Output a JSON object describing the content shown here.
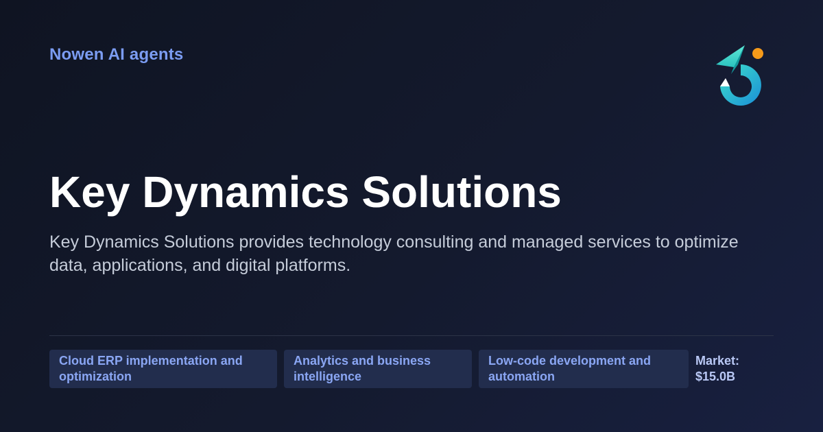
{
  "brand": {
    "name": "Nowen AI agents"
  },
  "company": {
    "title": "Key Dynamics Solutions",
    "description": "Key Dynamics Solutions provides technology consulting and managed services to optimize data, applications, and digital platforms."
  },
  "tags": [
    {
      "label": "Cloud ERP implementation and optimization"
    },
    {
      "label": "Analytics and business intelligence"
    },
    {
      "label": "Low-code development and automation"
    }
  ],
  "market": {
    "label": "Market:",
    "value": "$15.0B"
  },
  "colors": {
    "accent": "#7b9cf2",
    "logo_teal": "#2fd0c6",
    "logo_orange": "#f59a1a"
  },
  "icons": {
    "logo": "nowen-logo-icon"
  }
}
